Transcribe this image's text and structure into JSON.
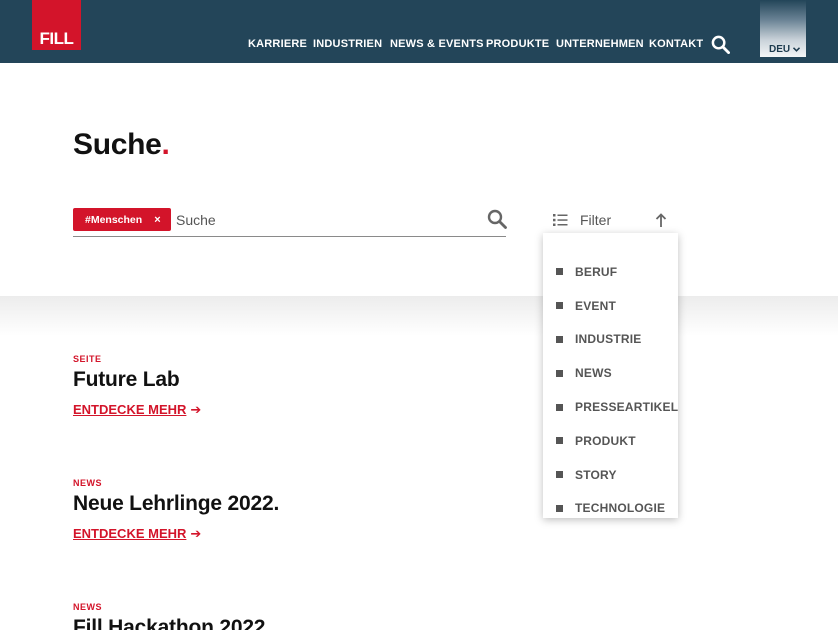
{
  "header": {
    "logo_text": "FILL",
    "nav": [
      {
        "label": "KARRIERE"
      },
      {
        "label": "INDUSTRIEN"
      },
      {
        "label": "NEWS & EVENTS"
      },
      {
        "label": "PRODUKTE"
      },
      {
        "label": "UNTERNEHMEN"
      },
      {
        "label": "KONTAKT"
      }
    ],
    "search_icon": "search-icon",
    "language": "DEU"
  },
  "page": {
    "title": "Suche",
    "title_dot": "."
  },
  "search": {
    "tag": "#Menschen",
    "tag_close": "×",
    "placeholder": "Suche",
    "value": ""
  },
  "filter": {
    "label": "Filter",
    "icon": "list-icon",
    "sort_icon": "arrow-up-icon",
    "options": [
      "BERUF",
      "EVENT",
      "INDUSTRIE",
      "NEWS",
      "PRESSEARTIKEL",
      "PRODUKT",
      "STORY",
      "TECHNOLOGIE"
    ]
  },
  "results": [
    {
      "category": "SEITE",
      "title": "Future Lab",
      "link": "ENTDECKE MEHR",
      "arrow": "➔"
    },
    {
      "category": "NEWS",
      "title": "Neue Lehrlinge 2022.",
      "link": "ENTDECKE MEHR",
      "arrow": "➔"
    },
    {
      "category": "NEWS",
      "title": "Fill Hackathon 2022",
      "link": "",
      "arrow": ""
    }
  ],
  "colors": {
    "header_bg": "#234559",
    "brand_red": "#d3142a"
  }
}
